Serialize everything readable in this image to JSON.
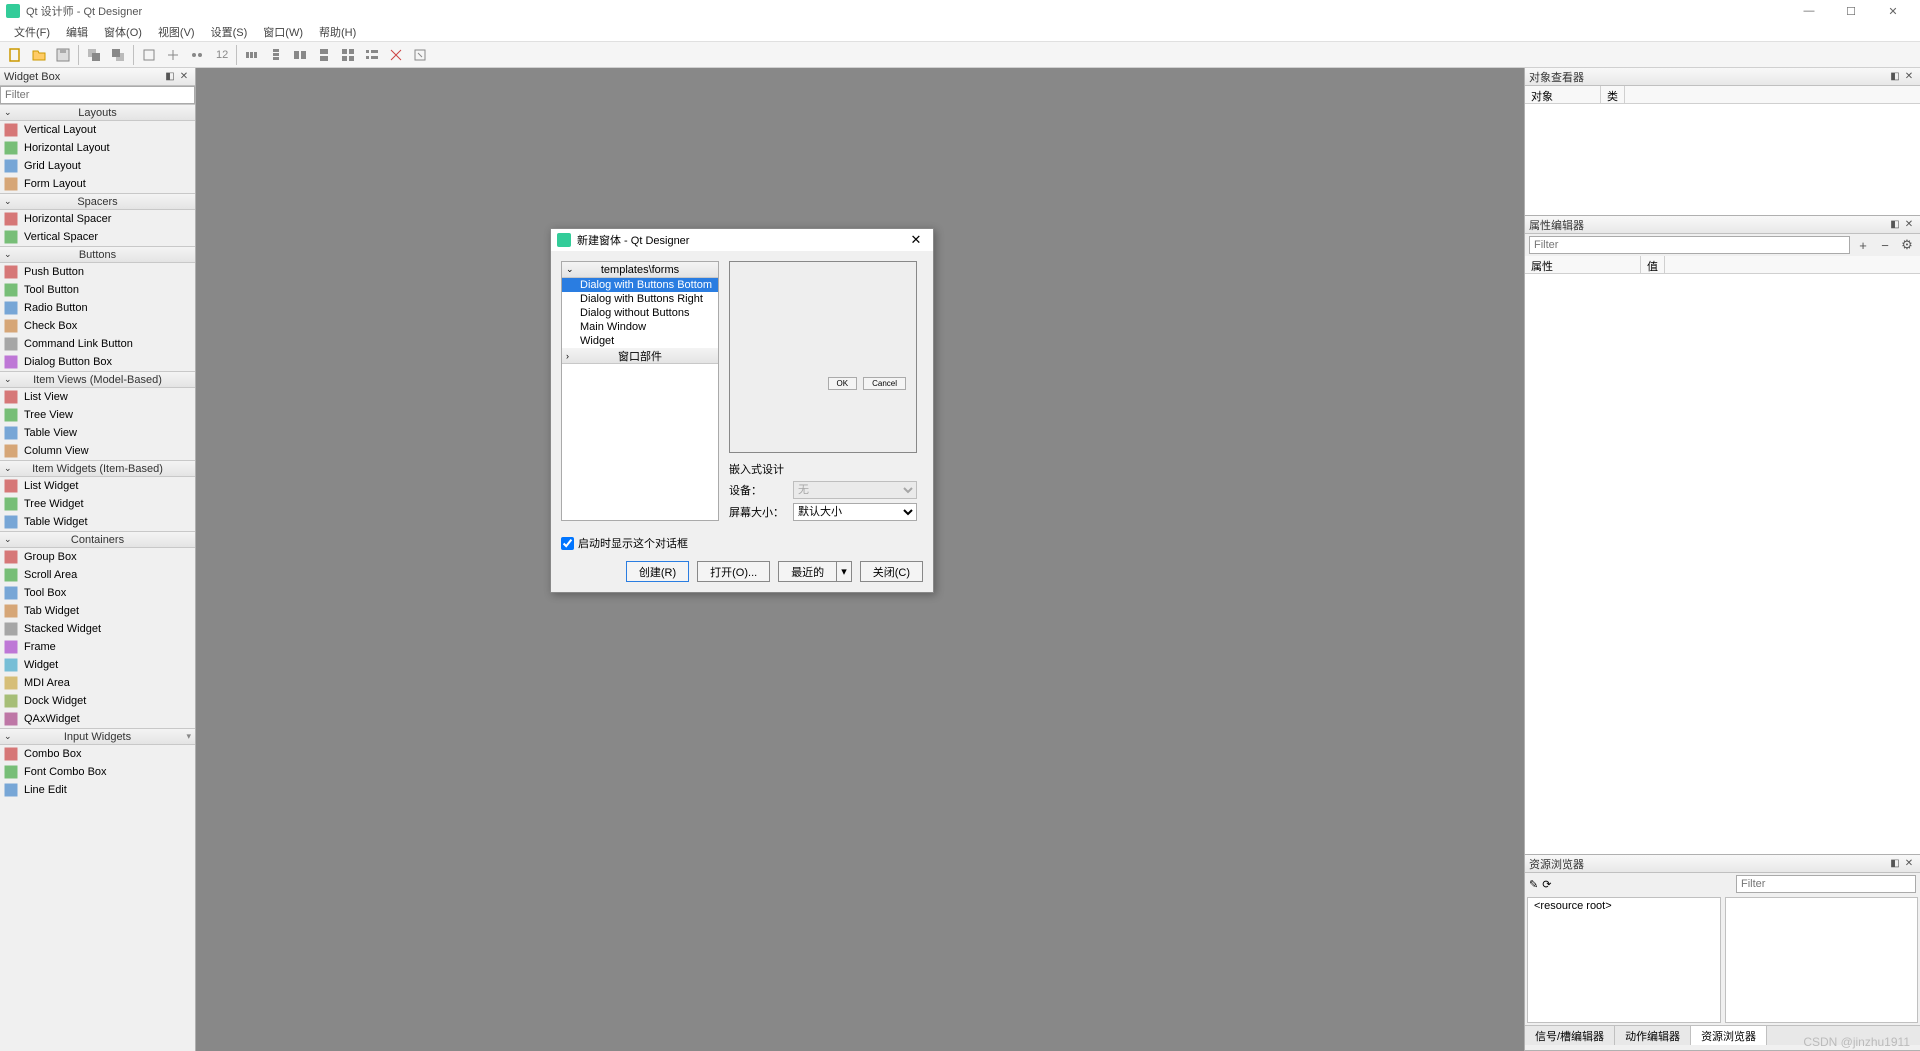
{
  "title": "Qt 设计师 - Qt Designer",
  "menus": [
    "文件(F)",
    "编辑",
    "窗体(O)",
    "视图(V)",
    "设置(S)",
    "窗口(W)",
    "帮助(H)"
  ],
  "widgetbox": {
    "title": "Widget Box",
    "filter_placeholder": "Filter",
    "cats": [
      {
        "name": "Layouts",
        "items": [
          "Vertical Layout",
          "Horizontal Layout",
          "Grid Layout",
          "Form Layout"
        ]
      },
      {
        "name": "Spacers",
        "items": [
          "Horizontal Spacer",
          "Vertical Spacer"
        ]
      },
      {
        "name": "Buttons",
        "items": [
          "Push Button",
          "Tool Button",
          "Radio Button",
          "Check Box",
          "Command Link Button",
          "Dialog Button Box"
        ]
      },
      {
        "name": "Item Views (Model-Based)",
        "items": [
          "List View",
          "Tree View",
          "Table View",
          "Column View"
        ]
      },
      {
        "name": "Item Widgets (Item-Based)",
        "items": [
          "List Widget",
          "Tree Widget",
          "Table Widget"
        ]
      },
      {
        "name": "Containers",
        "items": [
          "Group Box",
          "Scroll Area",
          "Tool Box",
          "Tab Widget",
          "Stacked Widget",
          "Frame",
          "Widget",
          "MDI Area",
          "Dock Widget",
          "QAxWidget"
        ]
      },
      {
        "name": "Input Widgets",
        "scroll": true,
        "items": [
          "Combo Box",
          "Font Combo Box",
          "Line Edit"
        ]
      }
    ]
  },
  "object_inspector": {
    "title": "对象查看器",
    "cols": [
      "对象",
      "类"
    ]
  },
  "property_editor": {
    "title": "属性编辑器",
    "filter_placeholder": "Filter",
    "cols": [
      "属性",
      "值"
    ]
  },
  "resource_browser": {
    "title": "资源浏览器",
    "filter_placeholder": "Filter",
    "root": "<resource root>",
    "tabs": [
      "信号/槽编辑器",
      "动作编辑器",
      "资源浏览器"
    ]
  },
  "dialog": {
    "title": "新建窗体 - Qt Designer",
    "tree_header": "templates\\forms",
    "tree_items": [
      "Dialog with Buttons Bottom",
      "Dialog with Buttons Right",
      "Dialog without Buttons",
      "Main Window",
      "Widget"
    ],
    "tree_footer": "窗口部件",
    "preview_ok": "OK",
    "preview_cancel": "Cancel",
    "embedded_title": "嵌入式设计",
    "device_label": "设备：",
    "device_value": "无",
    "size_label": "屏幕大小：",
    "size_value": "默认大小",
    "checkbox": "启动时显示这个对话框",
    "buttons": {
      "create": "创建(R)",
      "open": "打开(O)...",
      "recent": "最近的",
      "close": "关闭(C)"
    }
  },
  "watermark": "CSDN @jinzhu1911"
}
